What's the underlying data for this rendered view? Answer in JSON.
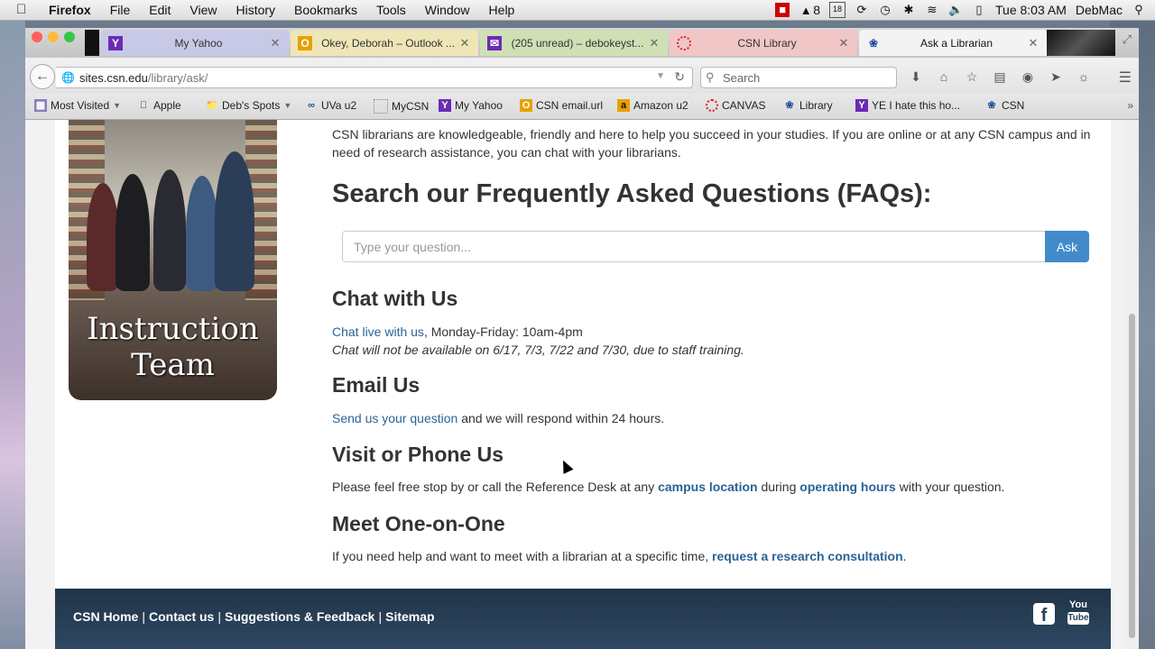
{
  "menubar": {
    "app": "Firefox",
    "items": [
      "File",
      "Edit",
      "View",
      "History",
      "Bookmarks",
      "Tools",
      "Window",
      "Help"
    ],
    "status": {
      "badge": "8",
      "calendar_day": "18",
      "clock": "Tue 8:03 AM",
      "user": "DebMac"
    }
  },
  "tabs": [
    {
      "label": "My Yahoo",
      "icon": "yahoo-icon",
      "color": "#c7c9e6"
    },
    {
      "label": "Okey, Deborah – Outlook ...",
      "icon": "outlook-icon",
      "color": "#efe6b8"
    },
    {
      "label": "(205 unread) – debokeyst...",
      "icon": "mail-icon",
      "color": "#cfe0b5"
    },
    {
      "label": "CSN Library",
      "icon": "canvas-icon",
      "color": "#f0c6c6"
    },
    {
      "label": "Ask a Librarian",
      "icon": "csn-icon",
      "color": "#f3f3f3"
    }
  ],
  "navbar": {
    "url_host": "sites.csn.edu",
    "url_path": "/library/ask/",
    "search_placeholder": "Search"
  },
  "bookmarks": [
    {
      "label": "Most Visited",
      "icon": "folder-icon"
    },
    {
      "label": "Apple",
      "icon": "apple-icon"
    },
    {
      "label": "Deb's Spots",
      "icon": "folder-icon"
    },
    {
      "label": "UVa u2",
      "icon": "link-icon"
    },
    {
      "label": "MyCSN",
      "icon": "page-icon"
    },
    {
      "label": "My Yahoo",
      "icon": "yahoo-icon"
    },
    {
      "label": "CSN email.url",
      "icon": "outlook-icon"
    },
    {
      "label": "Amazon u2",
      "icon": "amazon-icon"
    },
    {
      "label": "CANVAS",
      "icon": "canvas-icon"
    },
    {
      "label": "Library",
      "icon": "csn-icon"
    },
    {
      "label": "YE I hate this ho...",
      "icon": "yahoo-icon"
    },
    {
      "label": "CSN",
      "icon": "csn-icon"
    }
  ],
  "page": {
    "photo_caption_1": "Instruction",
    "photo_caption_2": "Team",
    "intro": "CSN librarians are knowledgeable, friendly and here to help you succeed in your studies. If you are online or at any CSN campus and in need of research assistance, you can chat with your librarians.",
    "faq_heading": "Search our Frequently Asked Questions (FAQs):",
    "faq_placeholder": "Type your question...",
    "ask_button": "Ask",
    "chat_heading": "Chat with Us",
    "chat_link": "Chat live with us",
    "chat_hours": ", Monday-Friday: 10am-4pm",
    "chat_note": "Chat will not be available on 6/17, 7/3, 7/22 and 7/30, due to staff training.",
    "email_heading": "Email Us",
    "email_link": "Send us your question",
    "email_text": " and we will respond within 24 hours.",
    "visit_heading": "Visit or Phone Us",
    "visit_text_1": "Please feel free stop by or call the Reference Desk at any ",
    "visit_link_1": "campus location",
    "visit_text_2": " during ",
    "visit_link_2": "operating hours",
    "visit_text_3": " with your question.",
    "meet_heading": "Meet One-on-One",
    "meet_text": "If you need help and want to meet with a librarian at a specific time, ",
    "meet_link": "request a research consultation",
    "meet_end": "."
  },
  "footer": {
    "links": [
      "CSN Home",
      "Contact us",
      "Suggestions & Feedback",
      "Sitemap"
    ],
    "social": [
      "facebook-icon",
      "youtube-icon"
    ],
    "youtube_you": "You",
    "youtube_tube": "Tube"
  }
}
